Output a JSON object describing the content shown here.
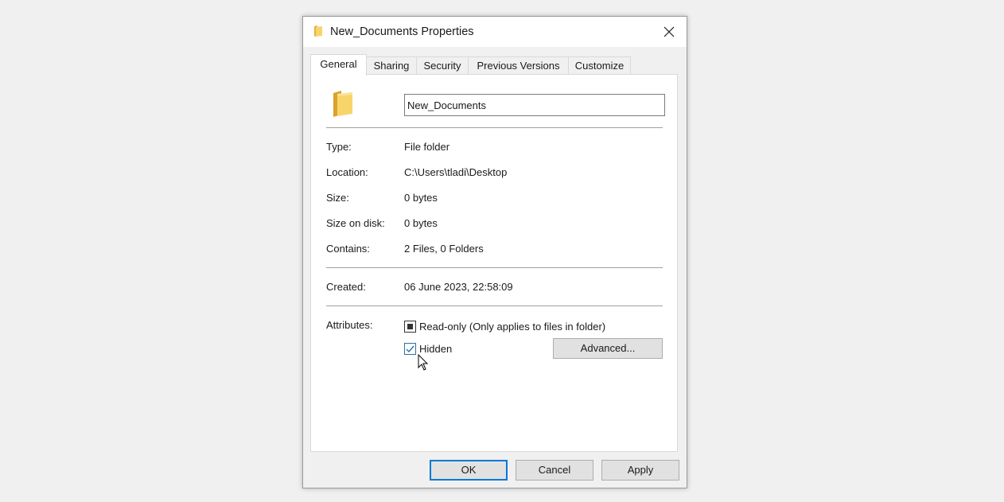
{
  "window": {
    "title": "New_Documents Properties",
    "icon": "folder-icon",
    "close_icon": "close-icon"
  },
  "tabs": [
    {
      "label": "General",
      "active": true
    },
    {
      "label": "Sharing",
      "active": false
    },
    {
      "label": "Security",
      "active": false
    },
    {
      "label": "Previous Versions",
      "active": false
    },
    {
      "label": "Customize",
      "active": false
    }
  ],
  "general": {
    "folder_name": "New_Documents",
    "properties": [
      {
        "label": "Type:",
        "value": "File folder"
      },
      {
        "label": "Location:",
        "value": "C:\\Users\\tladi\\Desktop"
      },
      {
        "label": "Size:",
        "value": "0 bytes"
      },
      {
        "label": "Size on disk:",
        "value": "0 bytes"
      },
      {
        "label": "Contains:",
        "value": "2 Files, 0 Folders"
      }
    ],
    "created": {
      "label": "Created:",
      "value": "06 June 2023, 22:58:09"
    },
    "attributes": {
      "label": "Attributes:",
      "readonly": {
        "label": "Read-only (Only applies to files in folder)",
        "state": "indeterminate"
      },
      "hidden": {
        "label": "Hidden",
        "state": "checked"
      },
      "advanced_label": "Advanced..."
    }
  },
  "buttons": {
    "ok": "OK",
    "cancel": "Cancel",
    "apply": "Apply"
  },
  "colors": {
    "accent": "#0078d7",
    "folder": "#f5c542"
  }
}
